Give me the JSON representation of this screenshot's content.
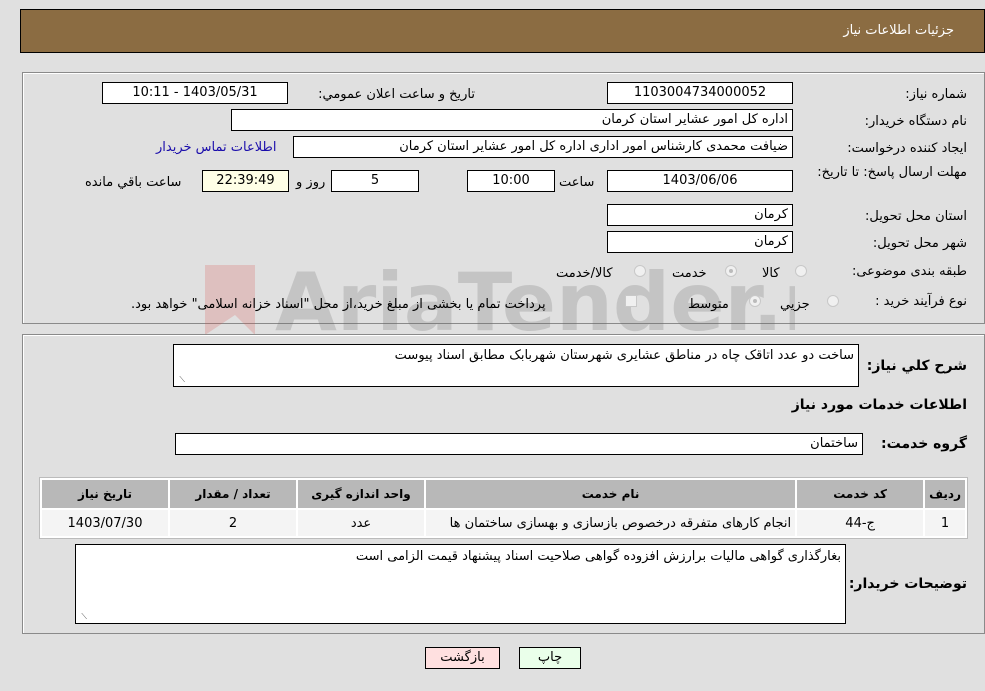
{
  "header": {
    "title": "جزئیات اطلاعات نیاز"
  },
  "form": {
    "need_number": {
      "label": "شماره نیاز:",
      "value": "1103004734000052"
    },
    "announce_datetime": {
      "label": "تاریخ و ساعت اعلان عمومي:",
      "value": "1403/05/31 - 10:11"
    },
    "buyer_org": {
      "label": "نام دستگاه خریدار:",
      "value": "اداره کل امور عشایر استان کرمان"
    },
    "requester": {
      "label": "ایجاد کننده درخواست:",
      "value": "ضیافت محمدی کارشناس امور اداری اداره کل امور عشایر استان کرمان"
    },
    "buyer_contact_link": "اطلاعات تماس خریدار",
    "deadline": {
      "label": "مهلت ارسال پاسخ: تا تاریخ:",
      "date": "1403/06/06",
      "time_label": "ساعت",
      "time": "10:00",
      "days": "5",
      "days_label": "روز و",
      "remaining": "22:39:49",
      "remaining_label": "ساعت باقي مانده"
    },
    "province": {
      "label": "استان محل تحویل:",
      "value": "کرمان"
    },
    "city": {
      "label": "شهر محل تحویل:",
      "value": "کرمان"
    },
    "category": {
      "label": "طبقه بندی موضوعی:",
      "options": [
        "کالا",
        "خدمت",
        "کالا/خدمت"
      ],
      "selected": "خدمت"
    },
    "purchase_type": {
      "label": "نوع فرآیند خرید :",
      "options": [
        "جزيي",
        "متوسط"
      ],
      "selected": "متوسط",
      "treasury_note": "پرداخت تمام یا بخشی از مبلغ خرید،از محل \"اسناد خزانه اسلامی\" خواهد بود."
    }
  },
  "details": {
    "description_label": "شرح كلي نياز:",
    "description": "ساخت دو عدد اتاقک چاه در مناطق عشایری شهرستان شهربابک مطابق اسناد پیوست",
    "services_heading": "اطلاعات خدمات مورد نیاز",
    "service_group_label": "گروه خدمت:",
    "service_group": "ساختمان",
    "table": {
      "headers": [
        "ردیف",
        "کد خدمت",
        "نام خدمت",
        "واحد اندازه گیری",
        "تعداد / مقدار",
        "تاریخ نیاز"
      ],
      "rows": [
        [
          "1",
          "ج-44",
          "انجام کارهای متفرقه درخصوص بازسازی و بهسازی ساختمان ها",
          "عدد",
          "2",
          "1403/07/30"
        ]
      ]
    },
    "buyer_notes_label": "توضیحات خریدار:",
    "buyer_notes": "بغارگذاری گواهی مالیات برارزش افزوده گواهی صلاحیت اسناد پیشنهاد قیمت الزامی است"
  },
  "buttons": {
    "print": "چاپ",
    "back": "بازگشت"
  },
  "watermark": "AriaTender.neT",
  "colors": {
    "header": "#8b6c42",
    "print_bg": "#eaffea",
    "back_bg": "#ffe0e0",
    "link": "#1a0dab"
  }
}
